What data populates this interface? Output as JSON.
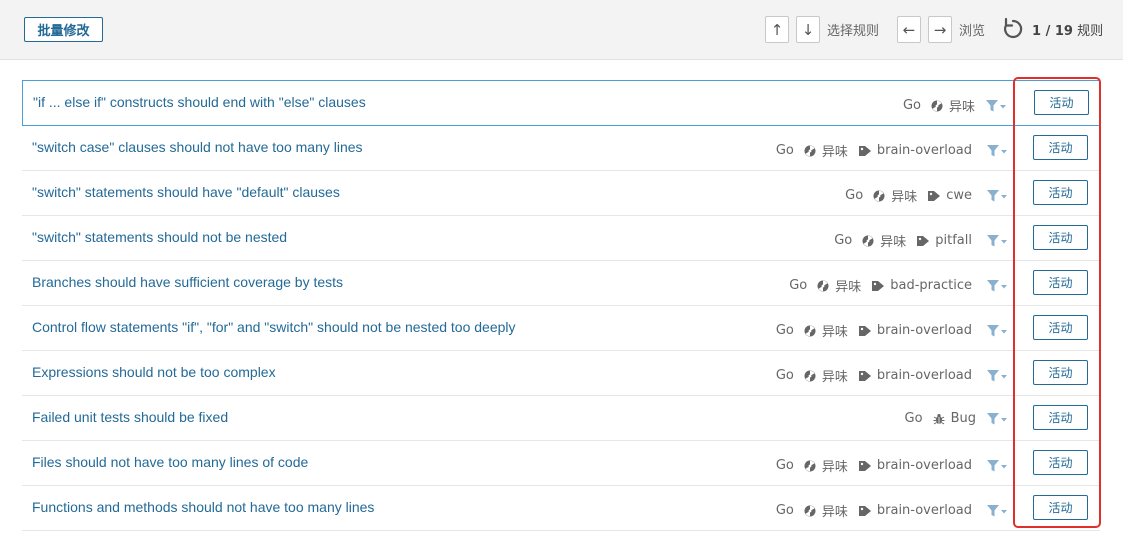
{
  "toolbar": {
    "bulk_change_label": "批量修改",
    "select_rule_label": "选择规则",
    "browse_label": "浏览",
    "up_arrow": "↑",
    "down_arrow": "↓",
    "left_arrow": "←",
    "right_arrow": "→",
    "current": "1",
    "separator": " / ",
    "total": "19",
    "rules_word": "规则"
  },
  "rules": [
    {
      "title": "\"if ... else if\" constructs should end with \"else\" clauses",
      "lang": "Go",
      "type": "异味",
      "type_icon": "code-smell-icon",
      "tag": "",
      "activate_label": "活动"
    },
    {
      "title": "\"switch case\" clauses should not have too many lines",
      "lang": "Go",
      "type": "异味",
      "type_icon": "code-smell-icon",
      "tag": "brain-overload",
      "activate_label": "活动"
    },
    {
      "title": "\"switch\" statements should have \"default\" clauses",
      "lang": "Go",
      "type": "异味",
      "type_icon": "code-smell-icon",
      "tag": "cwe",
      "activate_label": "活动"
    },
    {
      "title": "\"switch\" statements should not be nested",
      "lang": "Go",
      "type": "异味",
      "type_icon": "code-smell-icon",
      "tag": "pitfall",
      "activate_label": "活动"
    },
    {
      "title": "Branches should have sufficient coverage by tests",
      "lang": "Go",
      "type": "异味",
      "type_icon": "code-smell-icon",
      "tag": "bad-practice",
      "activate_label": "活动"
    },
    {
      "title": "Control flow statements \"if\", \"for\" and \"switch\" should not be nested too deeply",
      "lang": "Go",
      "type": "异味",
      "type_icon": "code-smell-icon",
      "tag": "brain-overload",
      "activate_label": "活动"
    },
    {
      "title": "Expressions should not be too complex",
      "lang": "Go",
      "type": "异味",
      "type_icon": "code-smell-icon",
      "tag": "brain-overload",
      "activate_label": "活动"
    },
    {
      "title": "Failed unit tests should be fixed",
      "lang": "Go",
      "type": "Bug",
      "type_icon": "bug-icon",
      "tag": "",
      "activate_label": "活动"
    },
    {
      "title": "Files should not have too many lines of code",
      "lang": "Go",
      "type": "异味",
      "type_icon": "code-smell-icon",
      "tag": "brain-overload",
      "activate_label": "活动"
    },
    {
      "title": "Functions and methods should not have too many lines",
      "lang": "Go",
      "type": "异味",
      "type_icon": "code-smell-icon",
      "tag": "brain-overload",
      "activate_label": "活动"
    }
  ],
  "colors": {
    "link": "#236a97",
    "highlight": "#e0302b",
    "selected_border": "#4b9fd5"
  }
}
